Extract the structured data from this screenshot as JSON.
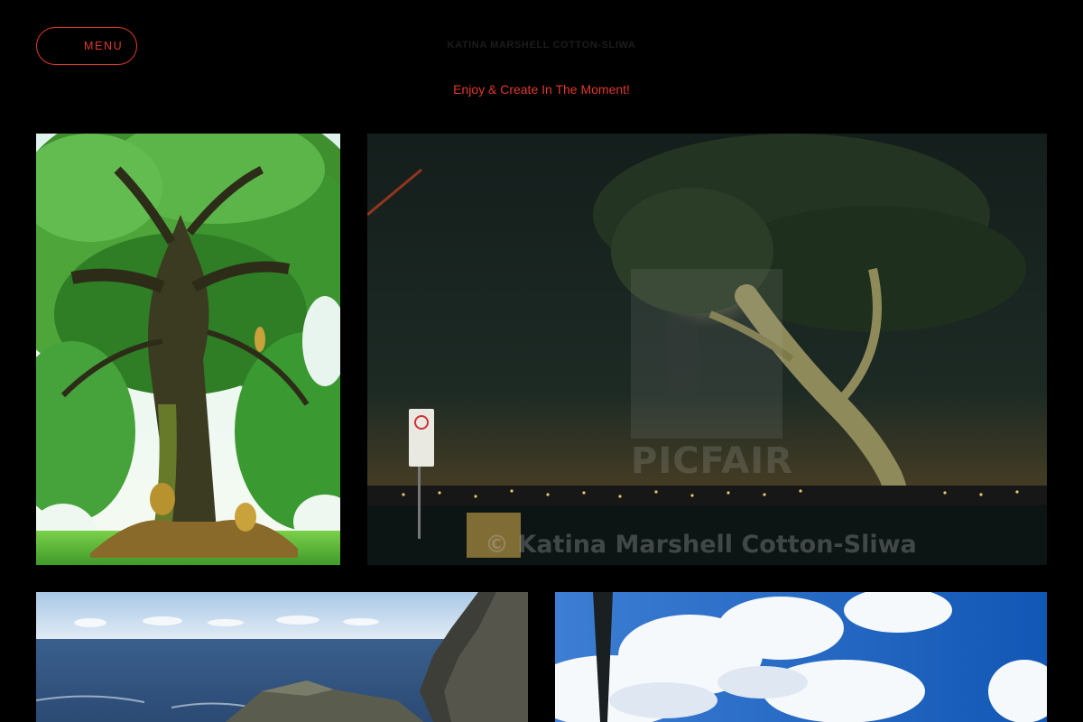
{
  "header": {
    "menu_label": "MENU",
    "site_title": "KATINA MARSHELL COTTON-SLIWA",
    "tagline": "Enjoy & Create In The Moment!"
  },
  "gallery": {
    "tile_2": {
      "watermark": "PICFAIR",
      "copyright": "© Katina Marshell Cotton-Sliwa"
    }
  },
  "colors": {
    "accent": "#e0382d",
    "background": "#000000"
  },
  "icons": {
    "menu": "hamburger-icon"
  }
}
